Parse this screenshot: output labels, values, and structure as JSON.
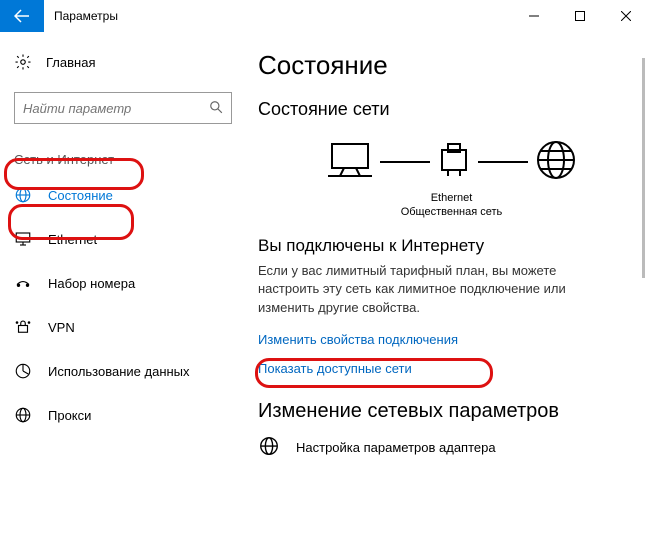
{
  "titlebar": {
    "app_title": "Параметры"
  },
  "sidebar": {
    "home_label": "Главная",
    "search_placeholder": "Найти параметр",
    "section_label": "Сеть и Интернет",
    "items": [
      {
        "label": "Состояние"
      },
      {
        "label": "Ethernet"
      },
      {
        "label": "Набор номера"
      },
      {
        "label": "VPN"
      },
      {
        "label": "Использование данных"
      },
      {
        "label": "Прокси"
      }
    ]
  },
  "main": {
    "heading": "Состояние",
    "net_status_heading": "Состояние сети",
    "diagram": {
      "middle_label": "Ethernet",
      "middle_sub": "Общественная сеть"
    },
    "connected_heading": "Вы подключены к Интернету",
    "connected_body": "Если у вас лимитный тарифный план, вы можете настроить эту сеть как лимитное подключение или изменить другие свойства.",
    "link_change_props": "Изменить свойства подключения",
    "link_show_nets": "Показать доступные сети",
    "change_params_heading": "Изменение сетевых параметров",
    "adapter_label": "Настройка параметров адаптера"
  }
}
